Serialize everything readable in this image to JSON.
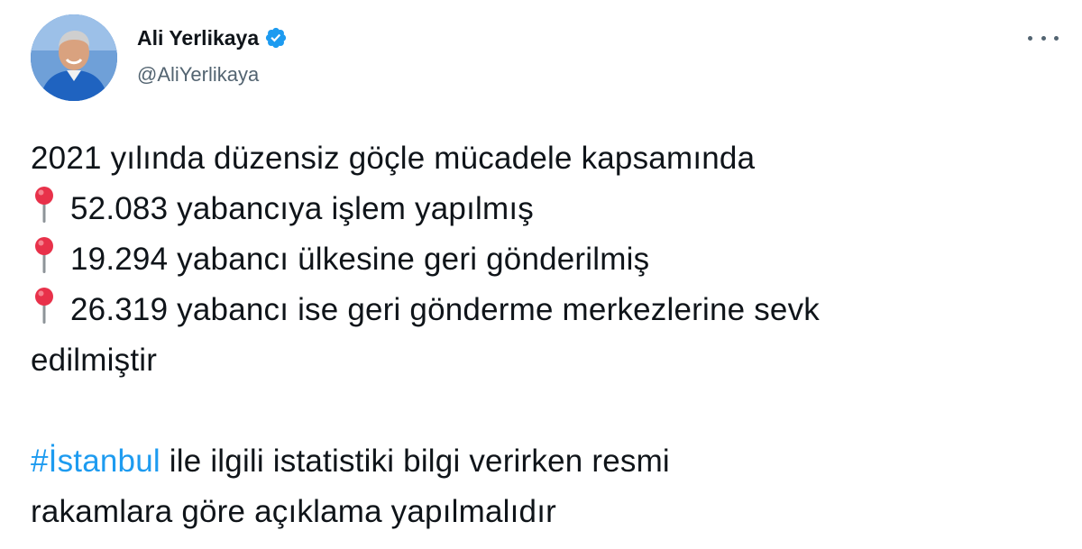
{
  "author": {
    "display_name": "Ali Yerlikaya",
    "handle": "@AliYerlikaya",
    "verified": true,
    "avatar_icon": "profile-photo",
    "verified_icon": "verified-badge-icon"
  },
  "more_icon": "more-options-icon",
  "tweet": {
    "line1": "2021 yılında düzensiz göçle mücadele kapsamında",
    "bullet_icon": "round-pushpin-icon",
    "bullets": [
      "52.083 yabancıya işlem yapılmış",
      "19.294 yabancı ülkesine geri gönderilmiş",
      "26.319 yabancı ise geri gönderme merkezlerine sevk"
    ],
    "continuation": "edilmiştir",
    "hashtag": "#İstanbul",
    "p2_rest": " ile ilgili istatistiki bilgi verirken resmi",
    "p2_line2": "rakamlara göre açıklama yapılmalıdır"
  },
  "colors": {
    "link": "#1d9bf0",
    "text": "#0f1419",
    "secondary": "#536471",
    "pin": "#e8314a"
  }
}
